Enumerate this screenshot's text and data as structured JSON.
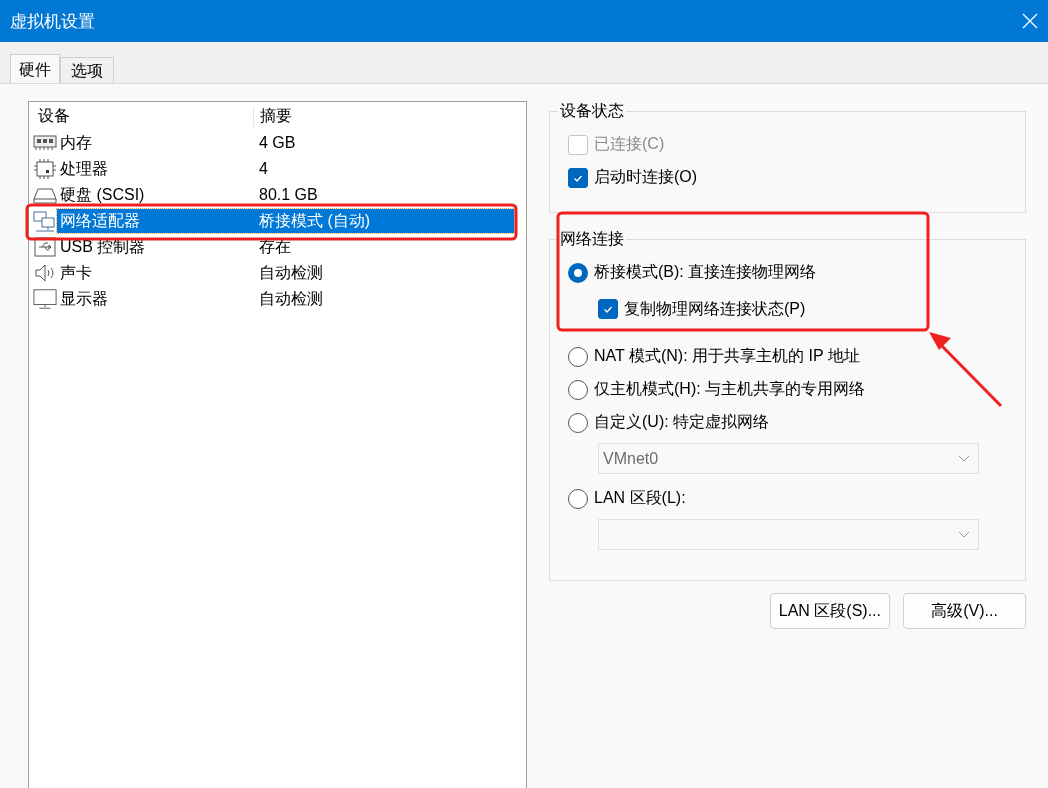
{
  "window": {
    "title": "虚拟机设置"
  },
  "tabs": [
    {
      "label": "硬件",
      "selected": true
    },
    {
      "label": "选项",
      "selected": false
    }
  ],
  "device_list": {
    "columns": [
      "设备",
      "摘要"
    ],
    "rows": [
      {
        "device": "内存",
        "summary": "4 GB",
        "selected": false
      },
      {
        "device": "处理器",
        "summary": "4",
        "selected": false
      },
      {
        "device": "硬盘 (SCSI)",
        "summary": "80.1 GB",
        "selected": false
      },
      {
        "device": "网络适配器",
        "summary": "桥接模式 (自动)",
        "selected": true
      },
      {
        "device": "USB 控制器",
        "summary": "存在",
        "selected": false
      },
      {
        "device": "声卡",
        "summary": "自动检测",
        "selected": false
      },
      {
        "device": "显示器",
        "summary": "自动检测",
        "selected": false
      }
    ]
  },
  "device_status": {
    "title": "设备状态",
    "checkboxes": [
      {
        "label": "已连接(C)",
        "checked": false,
        "disabled": true
      },
      {
        "label": "启动时连接(O)",
        "checked": true,
        "disabled": false
      }
    ]
  },
  "network_connection": {
    "title": "网络连接",
    "options": [
      {
        "label": "桥接模式(B): 直接连接物理网络",
        "selected": true,
        "sub_checkbox": {
          "label": "复制物理网络连接状态(P)",
          "checked": true
        }
      },
      {
        "label": "NAT 模式(N): 用于共享主机的 IP 地址",
        "selected": false
      },
      {
        "label": "仅主机模式(H): 与主机共享的专用网络",
        "selected": false
      },
      {
        "label": "自定义(U): 特定虚拟网络",
        "selected": false,
        "dropdown": {
          "value": "VMnet0",
          "disabled": true
        }
      },
      {
        "label": "LAN 区段(L):",
        "selected": false,
        "dropdown": {
          "disabled": true
        }
      }
    ]
  },
  "buttons": [
    "LAN 区段(S)...",
    "高级(V)..."
  ]
}
